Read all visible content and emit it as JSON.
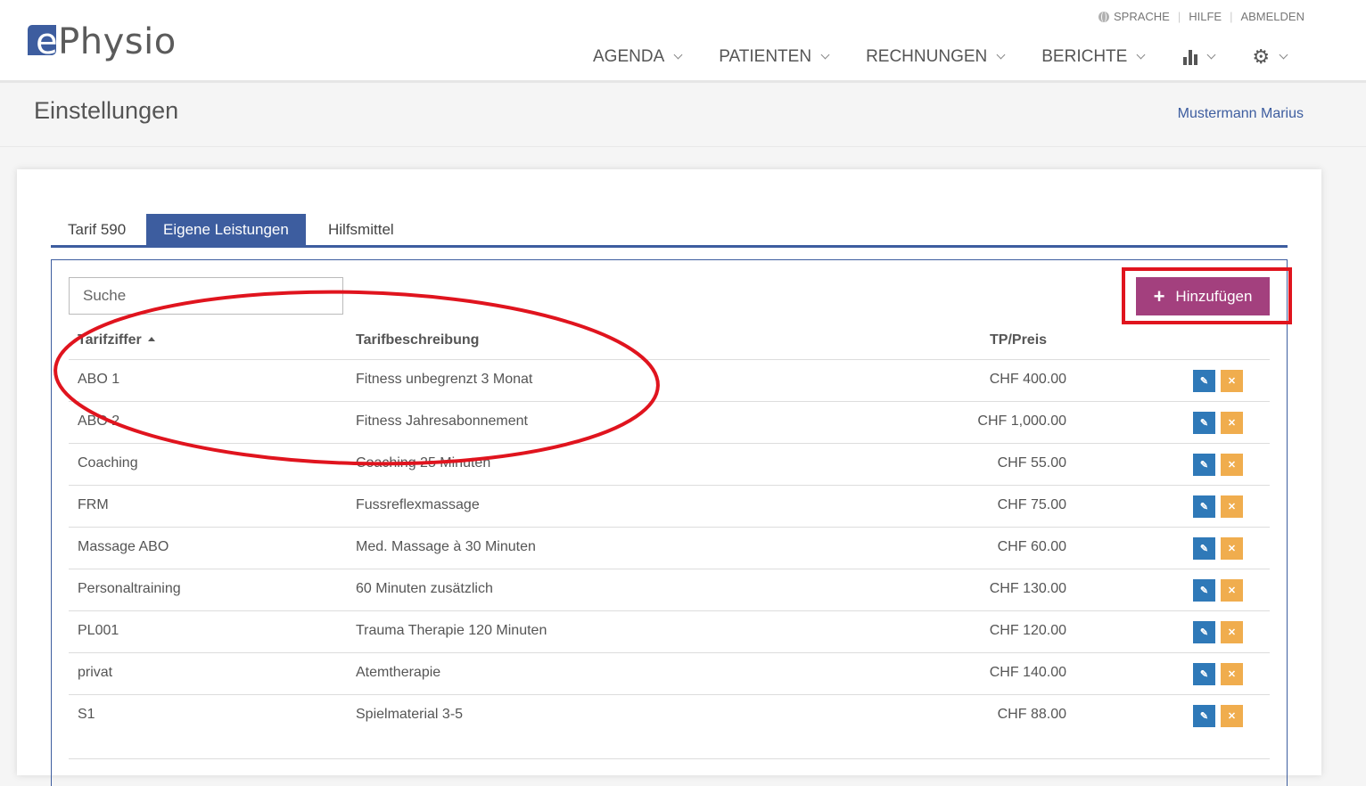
{
  "brand": {
    "logo_letter": "e",
    "logo_text": "Physio"
  },
  "util_links": {
    "language": "SPRACHE",
    "help": "HILFE",
    "logout": "ABMELDEN"
  },
  "nav": {
    "agenda": "AGENDA",
    "patients": "PATIENTEN",
    "invoices": "RECHNUNGEN",
    "reports": "BERICHTE"
  },
  "header": {
    "page_title": "Einstellungen",
    "user_name": "Mustermann Marius"
  },
  "tabs": [
    "Tarif 590",
    "Eigene Leistungen",
    "Hilfsmittel"
  ],
  "active_tab": "Eigene Leistungen",
  "search": {
    "placeholder": "Suche"
  },
  "add_button": {
    "label": "Hinzufügen"
  },
  "table": {
    "columns": {
      "code": "Tarifziffer",
      "description": "Tarifbeschreibung",
      "price": "TP/Preis"
    },
    "sort": {
      "column": "Tarifziffer",
      "direction": "ascending"
    },
    "rows": [
      {
        "code": "ABO 1",
        "description": "Fitness unbegrenzt 3 Monat",
        "price": "CHF 400.00"
      },
      {
        "code": "ABO 2",
        "description": "Fitness Jahresabonnement",
        "price": "CHF 1,000.00"
      },
      {
        "code": "Coaching",
        "description": "Coaching 25 Minuten",
        "price": "CHF 55.00"
      },
      {
        "code": "FRM",
        "description": "Fussreflexmassage",
        "price": "CHF 75.00"
      },
      {
        "code": "Massage ABO",
        "description": "Med. Massage à 30 Minuten",
        "price": "CHF 60.00"
      },
      {
        "code": "Personaltraining",
        "description": "60 Minuten zusätzlich",
        "price": "CHF 130.00"
      },
      {
        "code": "PL001",
        "description": "Trauma Therapie 120 Minuten",
        "price": "CHF 120.00"
      },
      {
        "code": "privat",
        "description": "Atemtherapie",
        "price": "CHF 140.00"
      },
      {
        "code": "S1",
        "description": "Spielmaterial 3-5",
        "price": "CHF 88.00"
      }
    ]
  },
  "icons": {
    "edit": "edit-icon",
    "delete": "close-icon",
    "stats": "bar-chart-icon",
    "settings": "gear-icon",
    "language": "globe-icon"
  },
  "colors": {
    "primary": "#3d5d9f",
    "add_button": "#a3407e",
    "edit_button": "#2f79b8",
    "delete_button": "#f0ad4e",
    "annotation": "#e0141e"
  }
}
